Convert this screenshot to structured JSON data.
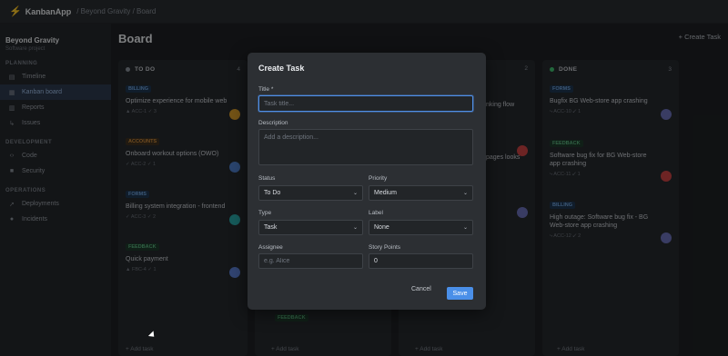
{
  "app": {
    "name": "KanbanApp",
    "breadcrumb": "/ Beyond Gravity / Board"
  },
  "sidebar": {
    "project_name": "Beyond Gravity",
    "project_sub": "Software project",
    "sections": [
      {
        "title": "PLANNING",
        "items": [
          {
            "label": "Timeline",
            "icon": "timeline-icon"
          },
          {
            "label": "Kanban board",
            "icon": "board-icon",
            "active": true
          },
          {
            "label": "Reports",
            "icon": "reports-icon"
          },
          {
            "label": "Issues",
            "icon": "issues-icon"
          }
        ]
      },
      {
        "title": "DEVELOPMENT",
        "items": [
          {
            "label": "Code",
            "icon": "code-icon"
          },
          {
            "label": "Security",
            "icon": "lock-icon"
          }
        ]
      },
      {
        "title": "OPERATIONS",
        "items": [
          {
            "label": "Deployments",
            "icon": "rocket-icon"
          },
          {
            "label": "Incidents",
            "icon": "bell-icon"
          }
        ]
      }
    ]
  },
  "board": {
    "title": "Board",
    "create_label": "+ Create Task",
    "add_task_label": "+ Add task",
    "columns": [
      {
        "title": "TO DO",
        "count": "4",
        "color": "#8a9099",
        "cards": [
          {
            "badge": "BILLING",
            "badge_class": "b-blue",
            "title": "Optimize experience for mobile web",
            "meta": "▲ ACC-1  ✓ 3",
            "avatar": "#d49a2a"
          },
          {
            "badge": "ACCOUNTS",
            "badge_class": "b-orange",
            "title": "Onboard workout options (OWO)",
            "meta": "✓ ACC-2  ✓ 1",
            "avatar": "#4f7fc9"
          },
          {
            "badge": "FORMS",
            "badge_class": "b-blue",
            "title": "Billing system integration - frontend",
            "meta": "✓ ACC-3  ✓ 2",
            "avatar": "#2aa6a6"
          },
          {
            "badge": "FEEDBACK",
            "badge_class": "b-green",
            "title": "Quick payment",
            "meta": "▲ FBC-4  ✓ 1",
            "avatar": "#5b7fd1"
          }
        ]
      },
      {
        "title": "DONE",
        "count": "3",
        "color": "#3fbf6f",
        "cards": [
          {
            "badge": "FORMS",
            "badge_class": "b-blue",
            "title": "Bugfix BG Web-store app crashing",
            "meta": "⤷ ACC-10  ✓ 1",
            "avatar": "#6a6fb8"
          },
          {
            "badge": "FEEDBACK",
            "badge_class": "b-green",
            "title": "Software bug fix for BG Web-store app crashing",
            "meta": "⤷ ACC-11  ✓ 1",
            "avatar": "#c94444"
          },
          {
            "badge": "BILLING",
            "badge_class": "b-blue",
            "title": "High outage: Software bug fix - BG Web-store app crashing",
            "meta": "⤷ ACC-12  ✓ 2",
            "avatar": "#6a6fb8"
          }
        ]
      }
    ],
    "middle": {
      "count_a": "2",
      "count_b": "2",
      "snippet_1": "nking flow",
      "snippet_2": "pages looks",
      "badge_bottom": "FEEDBACK"
    }
  },
  "modal": {
    "title": "Create Task",
    "title_label": "Title *",
    "title_placeholder": "Task title...",
    "description_label": "Description",
    "description_placeholder": "Add a description...",
    "status_label": "Status",
    "status_value": "To Do",
    "priority_label": "Priority",
    "priority_value": "Medium",
    "type_label": "Type",
    "type_value": "Task",
    "label_label": "Label",
    "label_value": "None",
    "assignee_label": "Assignee",
    "assignee_placeholder": "e.g. Alice",
    "points_label": "Story Points",
    "points_value": "0",
    "cancel_label": "Cancel",
    "save_label": "Save"
  }
}
